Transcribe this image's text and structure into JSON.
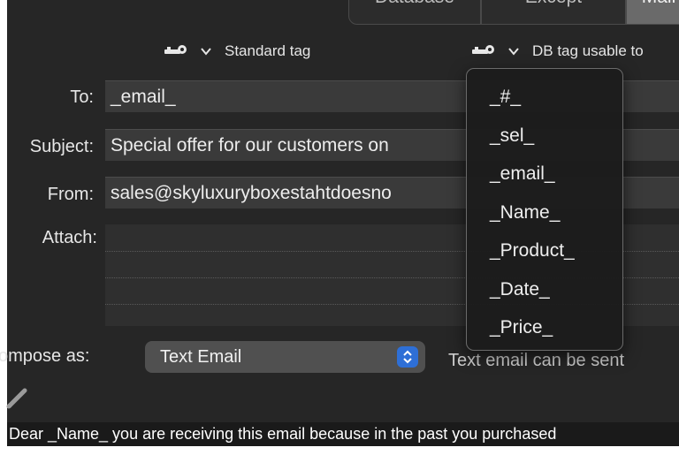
{
  "tabs": [
    {
      "label": "Database",
      "active": false
    },
    {
      "label": "Except",
      "active": false
    },
    {
      "label": "Mail",
      "active": true
    }
  ],
  "tag_pickers": {
    "standard": {
      "label": "Standard tag",
      "icon": "key-icon"
    },
    "db": {
      "label": "DB tag usable to",
      "icon": "key-icon"
    }
  },
  "form": {
    "to_label": "To:",
    "to_value": "_email_",
    "subject_label": "Subject:",
    "subject_value": "Special offer for our customers on",
    "from_label": "From:",
    "from_value": "sales@skyluxuryboxestahtdoesno",
    "attach_label": "Attach:"
  },
  "compose": {
    "label": "ompose as:",
    "selected": "Text Email",
    "note": "Text email can be sent"
  },
  "body_text": "Dear _Name_  you are receiving this email because in the past you purchased",
  "db_tag_menu": {
    "items": [
      "_#_",
      "_sel_",
      "_email_",
      "_Name_",
      "_Product_",
      "_Date_",
      "_Price_"
    ]
  },
  "colors": {
    "background": "#262626",
    "field": "#3a3a3a",
    "accent": "#2e6fd6"
  }
}
